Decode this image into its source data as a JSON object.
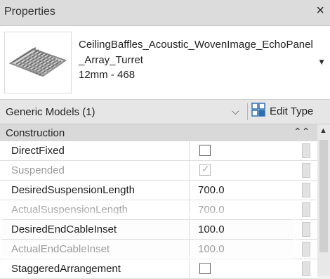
{
  "window": {
    "title": "Properties",
    "close_glyph": "×"
  },
  "type_selector": {
    "name": "CeilingBaffles_Acoustic_WovenImage_EchoPanel_Array_Turret",
    "size": "12mm - 468",
    "dropdown_glyph": "▼",
    "thumbnail_icon": "woven-baffle-thumbnail-icon"
  },
  "category": {
    "label": "Generic Models (1)",
    "chevron_glyph": "⌵",
    "edit_type_label": "Edit Type",
    "edit_type_icon": "edit-type-icon"
  },
  "group": {
    "label": "Construction",
    "collapse_glyph": "⌃⌃"
  },
  "scrollbar": {
    "up_glyph": "▲"
  },
  "rows": [
    {
      "name": "DirectFixed",
      "value": "",
      "kind": "checkbox",
      "checked": false,
      "enabled": true
    },
    {
      "name": "Suspended",
      "value": "",
      "kind": "checkbox",
      "checked": true,
      "enabled": false
    },
    {
      "name": "DesiredSuspensionLength",
      "value": "700.0",
      "kind": "text",
      "enabled": true
    },
    {
      "name": "ActualSuspensionLength",
      "value": "700.0",
      "kind": "text",
      "enabled": false
    },
    {
      "name": "DesiredEndCableInset",
      "value": "100.0",
      "kind": "text",
      "enabled": true
    },
    {
      "name": "ActualEndCableInset",
      "value": "100.0",
      "kind": "text",
      "enabled": false
    },
    {
      "name": "StaggeredArrangement",
      "value": "",
      "kind": "checkbox",
      "checked": false,
      "enabled": true
    }
  ],
  "colors": {
    "title_bar": "#dcdcdc",
    "group_header": "#d9d9d9",
    "disabled_text": "#9b9b9b"
  }
}
